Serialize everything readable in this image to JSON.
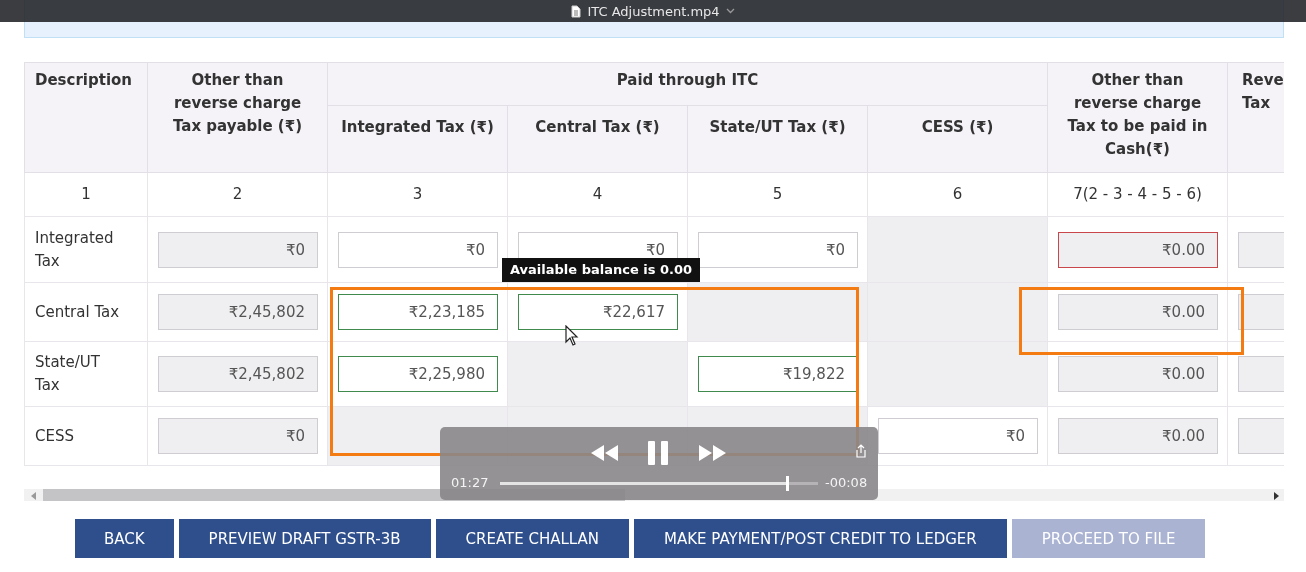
{
  "video_player": {
    "title": "ITC Adjustment.mp4",
    "playing": true,
    "elapsed": "01:27",
    "remaining": "-00:08",
    "level": 0.91
  },
  "table": {
    "columns": [
      {
        "label": "Description"
      },
      {
        "label": "Other than reverse charge Tax payable (₹)"
      },
      {
        "label": "Paid through ITC",
        "colspan": 4,
        "children": [
          {
            "label": "Integrated Tax (₹)"
          },
          {
            "label": "Central Tax (₹)"
          },
          {
            "label": "State/UT Tax (₹)"
          },
          {
            "label": "CESS (₹)"
          }
        ]
      },
      {
        "label": "Other than reverse charge Tax to be paid in Cash(₹)"
      },
      {
        "label": "Reve Tax"
      }
    ],
    "column_numbers": [
      "1",
      "2",
      "3",
      "4",
      "5",
      "6",
      "7(2 - 3 - 4 - 5 - 6)"
    ],
    "rows": [
      {
        "cells": [
          {
            "kind": "label",
            "value": "Integrated Tax"
          },
          {
            "kind": "readonly",
            "value": "₹0"
          },
          {
            "kind": "input",
            "value": "₹0"
          },
          {
            "kind": "input",
            "value": "₹0"
          },
          {
            "kind": "input",
            "value": "₹0"
          },
          {
            "kind": "blank"
          },
          {
            "kind": "error",
            "value": "₹0.00"
          },
          {
            "kind": "readonly"
          }
        ]
      },
      {
        "cells": [
          {
            "kind": "label",
            "value": "Central Tax"
          },
          {
            "kind": "readonly",
            "value": "₹2,45,802"
          },
          {
            "kind": "valid",
            "value": "₹2,23,185"
          },
          {
            "kind": "valid",
            "value": "₹22,617"
          },
          {
            "kind": "blank"
          },
          {
            "kind": "blank"
          },
          {
            "kind": "readonly",
            "value": "₹0.00"
          },
          {
            "kind": "readonly"
          }
        ]
      },
      {
        "cells": [
          {
            "kind": "label",
            "value": "State/UT Tax"
          },
          {
            "kind": "readonly",
            "value": "₹2,45,802"
          },
          {
            "kind": "valid",
            "value": "₹2,25,980"
          },
          {
            "kind": "blank"
          },
          {
            "kind": "valid",
            "value": "₹19,822"
          },
          {
            "kind": "blank"
          },
          {
            "kind": "readonly",
            "value": "₹0.00"
          },
          {
            "kind": "readonly"
          }
        ]
      },
      {
        "cells": [
          {
            "kind": "label",
            "value": "CESS"
          },
          {
            "kind": "readonly",
            "value": "₹0"
          },
          {
            "kind": "blank"
          },
          {
            "kind": "blank"
          },
          {
            "kind": "blank"
          },
          {
            "kind": "input",
            "value": "₹0"
          },
          {
            "kind": "readonly",
            "value": "₹0.00"
          },
          {
            "kind": "readonly"
          }
        ]
      }
    ]
  },
  "tooltip": "Available balance is 0.00",
  "buttons": [
    {
      "label": "BACK",
      "disabled": false
    },
    {
      "label": "PREVIEW DRAFT GSTR-3B",
      "disabled": false
    },
    {
      "label": "CREATE CHALLAN",
      "disabled": false
    },
    {
      "label": "MAKE PAYMENT/POST CREDIT TO LEDGER",
      "disabled": false
    },
    {
      "label": "PROCEED TO FILE",
      "disabled": true
    }
  ]
}
